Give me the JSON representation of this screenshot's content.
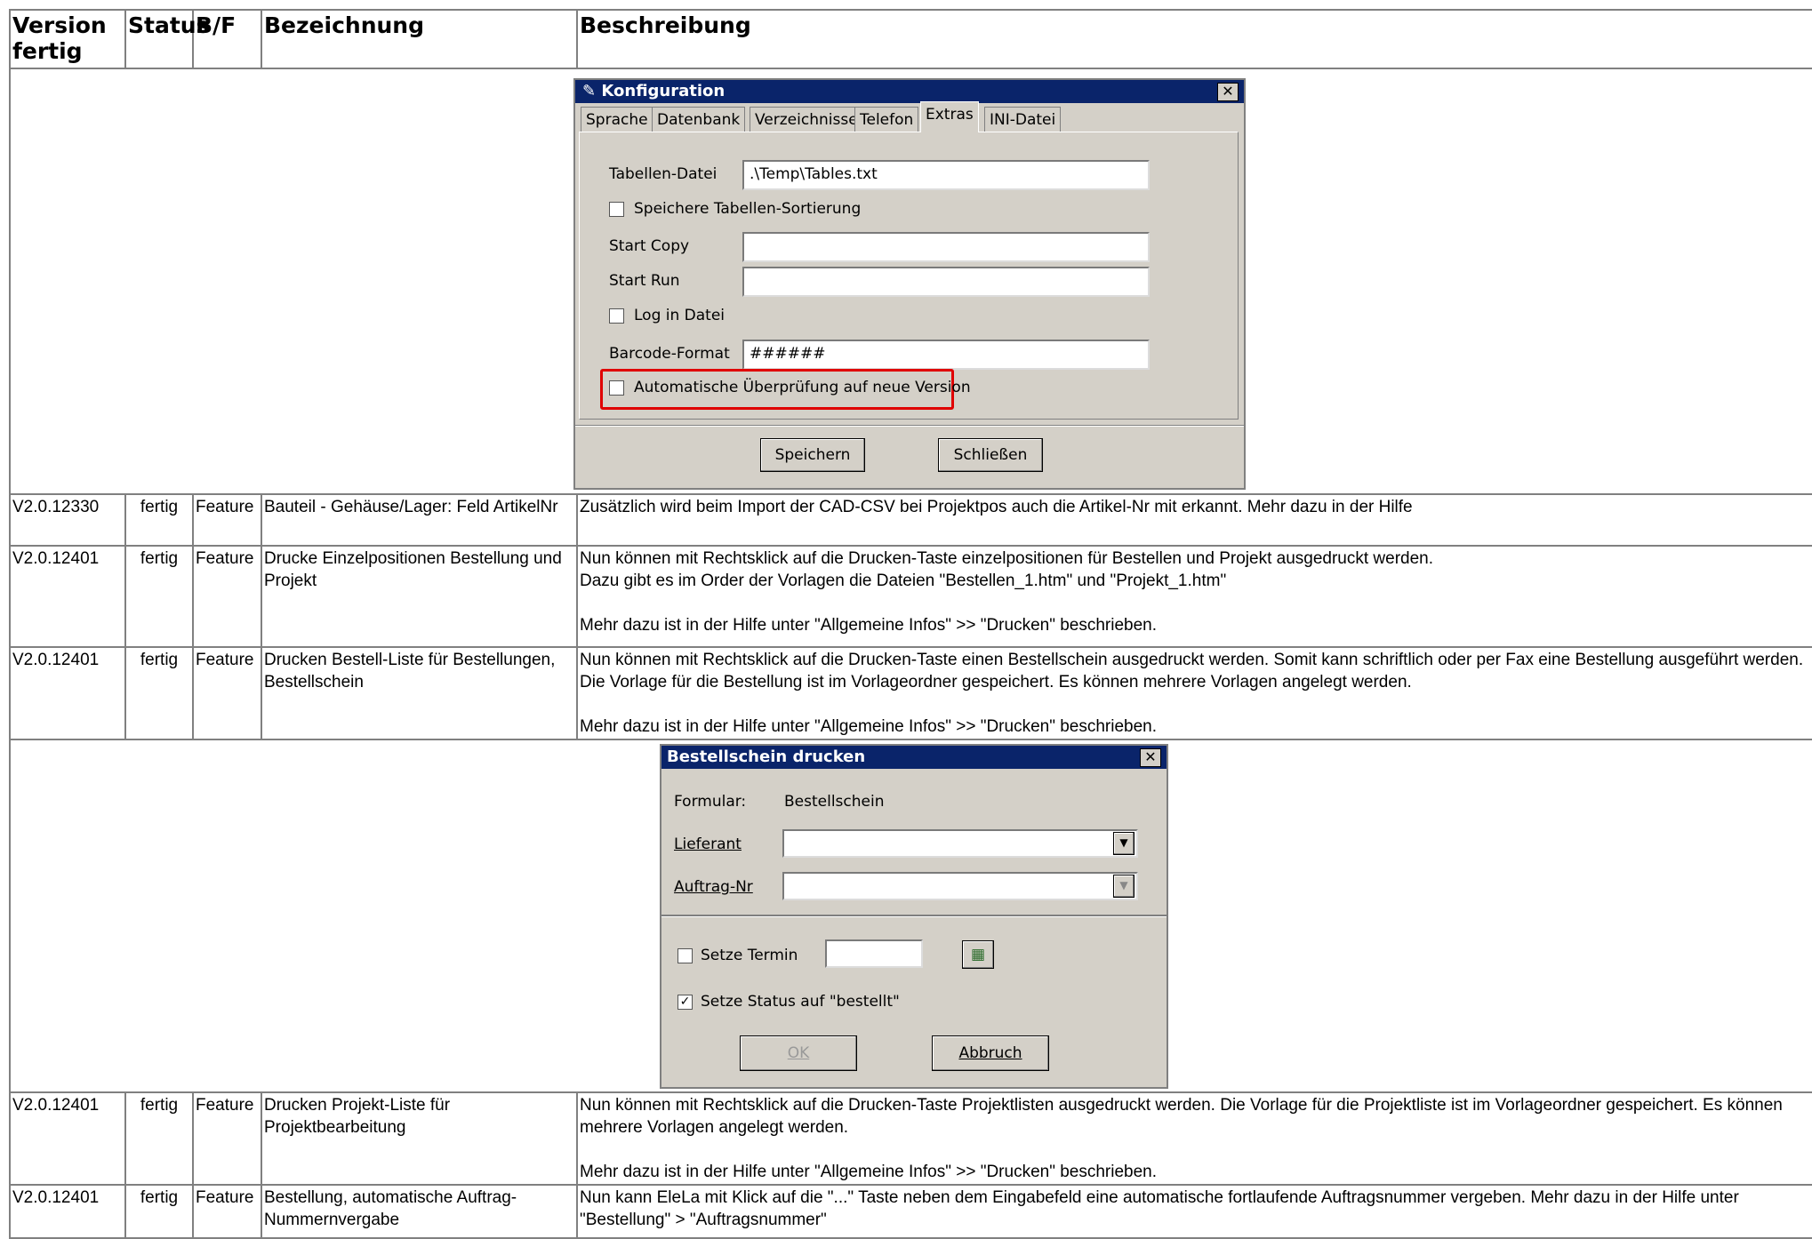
{
  "headers": [
    "Version fertig",
    "Status",
    "B/F",
    "Bezeichnung",
    "Beschreibung"
  ],
  "rows": [
    {
      "version": "V2.0.12330",
      "status": "fertig",
      "bf": "Feature",
      "bez": "Bauteil - Gehäuse/Lager: Feld ArtikelNr",
      "desc": "Zusätzlich wird beim Import der CAD-CSV bei Projektpos auch die Artikel-Nr mit erkannt. Mehr dazu in der Hilfe"
    },
    {
      "version": "V2.0.12401",
      "status": "fertig",
      "bf": "Feature",
      "bez": "Drucke Einzelpositionen Bestellung und Projekt",
      "desc": "Nun können mit Rechtsklick auf die Drucken-Taste einzelpositionen für Bestellen und Projekt ausgedruckt werden.\nDazu gibt es im Order der Vorlagen die Dateien \"Bestellen_1.htm\" und \"Projekt_1.htm\"\n\nMehr dazu ist in der Hilfe unter \"Allgemeine Infos\" >> \"Drucken\" beschrieben."
    },
    {
      "version": "V2.0.12401",
      "status": "fertig",
      "bf": "Feature",
      "bez": "Drucken Bestell-Liste für Bestellungen, Bestellschein",
      "desc": "Nun können mit Rechtsklick auf die Drucken-Taste einen Bestellschein ausgedruckt werden. Somit kann schriftlich oder per Fax eine Bestellung ausgeführt werden. Die Vorlage für die Bestellung ist im Vorlageordner gespeichert. Es können mehrere Vorlagen angelegt werden.\n\nMehr dazu ist in der Hilfe unter \"Allgemeine Infos\" >> \"Drucken\" beschrieben."
    },
    {
      "version": "V2.0.12401",
      "status": "fertig",
      "bf": "Feature",
      "bez": "Drucken Projekt-Liste für Projektbearbeitung",
      "desc": "Nun können mit Rechtsklick auf die Drucken-Taste Projektlisten ausgedruckt werden. Die Vorlage für die Projektliste ist im Vorlageordner gespeichert. Es können mehrere Vorlagen angelegt werden.\n\nMehr dazu ist in der Hilfe unter \"Allgemeine Infos\" >> \"Drucken\" beschrieben."
    },
    {
      "version": "V2.0.12401",
      "status": "fertig",
      "bf": "Feature",
      "bez": "Bestellung, automatische Auftrag-Nummernvergabe",
      "desc": "Nun kann EleLa mit Klick auf die \"...\" Taste neben dem Eingabefeld eine automatische fortlaufende Auftragsnummer vergeben. Mehr dazu in der Hilfe unter \"Bestellung\" > \"Auftragsnummer\""
    }
  ],
  "config_dialog": {
    "title": "Konfiguration",
    "tabs": [
      "Sprache",
      "Datenbank",
      "Verzeichnisse",
      "Telefon",
      "Extras",
      "INI-Datei"
    ],
    "active_tab": "Extras",
    "tabellen_label": "Tabellen-Datei",
    "tabellen_value": ".\\Temp\\Tables.txt",
    "sort_label": "Speichere Tabellen-Sortierung",
    "start_copy_label": "Start Copy",
    "start_run_label": "Start Run",
    "log_label": "Log in Datei",
    "barcode_label": "Barcode-Format",
    "barcode_value": "######",
    "auto_check_label": "Automatische Überprüfung auf neue Version",
    "save_label": "Speichern",
    "close_label": "Schließen",
    "highlight_color": "#e00000"
  },
  "order_dialog": {
    "title": "Bestellschein drucken",
    "formular_label": "Formular:",
    "formular_value": "Bestellschein",
    "lieferant_label": "Lieferant",
    "auftrag_label": "Auftrag-Nr",
    "termin_label": "Setze Termin",
    "status_label": "Setze Status auf \"bestellt\"",
    "ok_label": "OK",
    "cancel_label": "Abbruch"
  }
}
